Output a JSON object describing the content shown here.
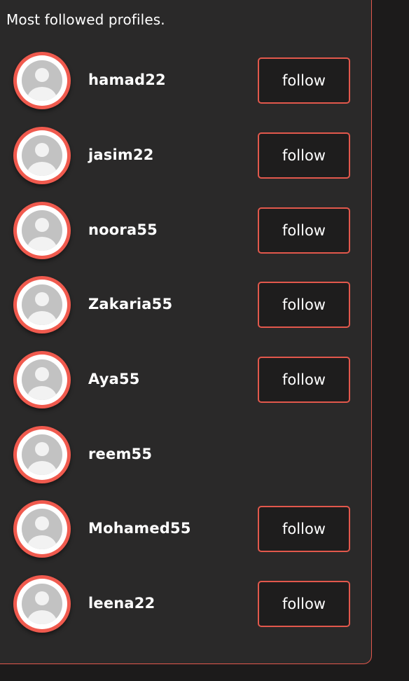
{
  "header": {
    "title": "Most followed profiles."
  },
  "colors": {
    "accent": "#e2584c",
    "avatar_ring": "#f05a4e",
    "panel_bg": "#2a2929",
    "page_bg": "#1c1b1b",
    "avatar_placeholder": "#c2c2c2"
  },
  "profiles": [
    {
      "username": "hamad22",
      "follow_label": "follow",
      "avatar_icon": "user-placeholder-icon"
    },
    {
      "username": "jasim22",
      "follow_label": "follow",
      "avatar_icon": "user-placeholder-icon"
    },
    {
      "username": "noora55",
      "follow_label": "follow",
      "avatar_icon": "user-placeholder-icon"
    },
    {
      "username": "Zakaria55",
      "follow_label": "follow",
      "avatar_icon": "user-placeholder-icon"
    },
    {
      "username": "Aya55",
      "follow_label": "follow",
      "avatar_icon": "user-placeholder-icon"
    },
    {
      "username": "reem55",
      "follow_label": "",
      "avatar_icon": "user-placeholder-icon"
    },
    {
      "username": "Mohamed55",
      "follow_label": "follow",
      "avatar_icon": "user-placeholder-icon"
    },
    {
      "username": "leena22",
      "follow_label": "follow",
      "avatar_icon": "user-placeholder-icon"
    }
  ]
}
